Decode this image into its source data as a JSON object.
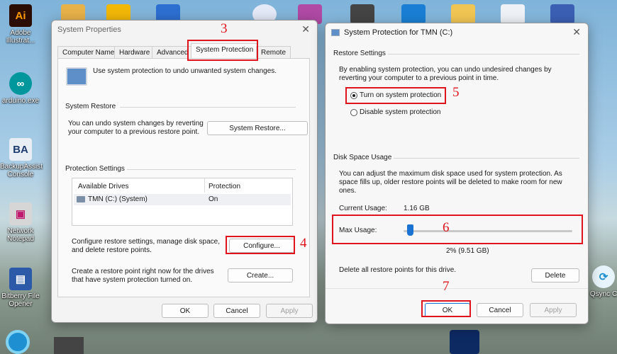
{
  "desktop": {
    "icons": [
      {
        "label": "Adobe Illustrat..."
      },
      {
        "label": "arduino.exe"
      },
      {
        "label": "BackupAssist Console"
      },
      {
        "label": "Network Notepad"
      },
      {
        "label": "Bitberry File Opener"
      },
      {
        "label": "Qsync C"
      }
    ]
  },
  "system_properties": {
    "title": "System Properties",
    "tabs": [
      "Computer Name",
      "Hardware",
      "Advanced",
      "System Protection",
      "Remote"
    ],
    "intro": "Use system protection to undo unwanted system changes.",
    "restore_group": "System Restore",
    "restore_text": "You can undo system changes by reverting your computer to a previous restore point.",
    "restore_button": "System Restore...",
    "protection_group": "Protection Settings",
    "table_headers": [
      "Available Drives",
      "Protection"
    ],
    "table_rows": [
      {
        "drive": "TMN (C:) (System)",
        "protection": "On"
      }
    ],
    "configure_text": "Configure restore settings, manage disk space, and delete restore points.",
    "configure_button": "Configure...",
    "create_text": "Create a restore point right now for the drives that have system protection turned on.",
    "create_button": "Create...",
    "ok": "OK",
    "cancel": "Cancel",
    "apply": "Apply"
  },
  "protection_dialog": {
    "title": "System Protection for TMN (C:)",
    "restore_group": "Restore Settings",
    "restore_text": "By enabling system protection, you can undo undesired changes by reverting your computer to a previous point in time.",
    "option_on": "Turn on system protection",
    "option_off": "Disable system protection",
    "selected_option": "Turn on system protection",
    "disk_group": "Disk Space Usage",
    "disk_text": "You can adjust the maximum disk space used for system protection. As space fills up, older restore points will be deleted to make room for new ones.",
    "current_label": "Current Usage:",
    "current_value": "1.16 GB",
    "max_label": "Max Usage:",
    "max_fraction": 0.02,
    "max_value": "2% (9.51 GB)",
    "delete_text": "Delete all restore points for this drive.",
    "delete_button": "Delete",
    "ok": "OK",
    "cancel": "Cancel",
    "apply": "Apply"
  },
  "annotations": {
    "step3": "3",
    "step4": "4",
    "step5": "5",
    "step6": "6",
    "step7": "7"
  }
}
